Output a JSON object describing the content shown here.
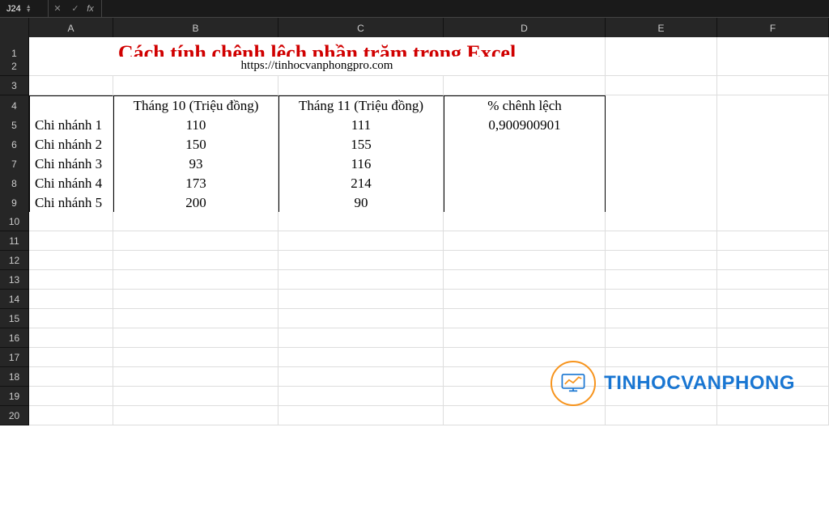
{
  "formula_bar": {
    "cell_ref": "J24",
    "fx_label": "fx",
    "input_value": ""
  },
  "columns": [
    "A",
    "B",
    "C",
    "D",
    "E",
    "F"
  ],
  "row_numbers": [
    "1",
    "2",
    "3",
    "4",
    "5",
    "6",
    "7",
    "8",
    "9",
    "10",
    "11",
    "12",
    "13",
    "14",
    "15",
    "16",
    "17",
    "18",
    "19",
    "20"
  ],
  "title": "Cách tính chênh lệch phần trăm trong Excel",
  "subtitle_url": "https://tinhocvanphongpro.com",
  "headers": {
    "a": "",
    "b": "Tháng 10 (Triệu đồng)",
    "c": "Tháng 11 (Triệu đồng)",
    "d": "% chênh lệch"
  },
  "rows": [
    {
      "a": "Chi nhánh 1",
      "b": "110",
      "c": "111",
      "d": "0,900900901"
    },
    {
      "a": "Chi nhánh 2",
      "b": "150",
      "c": "155",
      "d": ""
    },
    {
      "a": "Chi nhánh 3",
      "b": "93",
      "c": "116",
      "d": ""
    },
    {
      "a": "Chi nhánh 4",
      "b": "173",
      "c": "214",
      "d": ""
    },
    {
      "a": "Chi nhánh 5",
      "b": "200",
      "c": "90",
      "d": ""
    }
  ],
  "logo_text": "TINHOCVANPHONG",
  "chart_data": {
    "type": "table",
    "title": "Cách tính chênh lệch phần trăm trong Excel",
    "columns": [
      "Chi nhánh",
      "Tháng 10 (Triệu đồng)",
      "Tháng 11 (Triệu đồng)",
      "% chênh lệch"
    ],
    "rows": [
      [
        "Chi nhánh 1",
        110,
        111,
        0.900900901
      ],
      [
        "Chi nhánh 2",
        150,
        155,
        null
      ],
      [
        "Chi nhánh 3",
        93,
        116,
        null
      ],
      [
        "Chi nhánh 4",
        173,
        214,
        null
      ],
      [
        "Chi nhánh 5",
        200,
        90,
        null
      ]
    ]
  }
}
